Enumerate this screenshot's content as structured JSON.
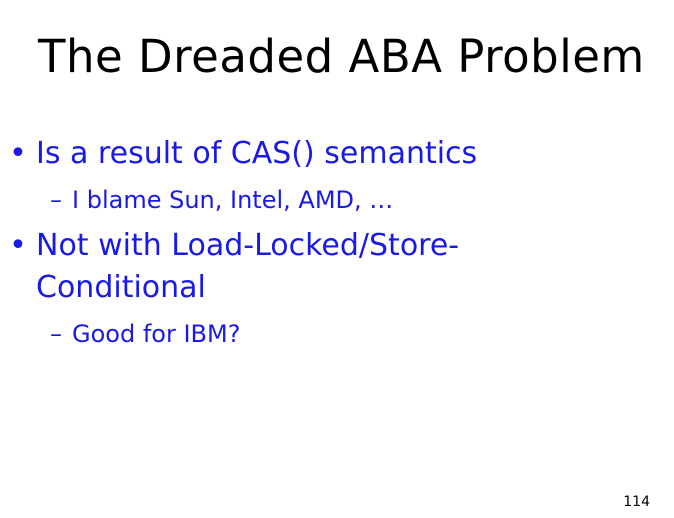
{
  "slide": {
    "title": "The Dreaded ABA Problem",
    "bullets": [
      {
        "marker": "•",
        "lines": [
          "Is a result of CAS() semantics"
        ],
        "sub": {
          "marker": "–",
          "text": "I blame Sun, Intel, AMD, …"
        }
      },
      {
        "marker": "•",
        "lines": [
          "Not with Load-Locked/Store-",
          "Conditional"
        ],
        "sub": {
          "marker": "–",
          "text": "Good for IBM?"
        }
      }
    ],
    "page_number": "114"
  },
  "colors": {
    "title": "#000000",
    "body": "#1a1ae6",
    "background": "#ffffff"
  }
}
